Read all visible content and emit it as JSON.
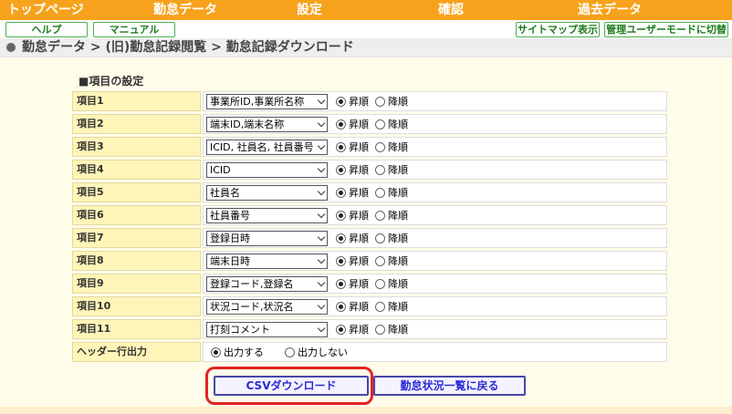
{
  "top_nav": [
    "トップページ",
    "勤怠データ",
    "設定",
    "確認",
    "過去データ"
  ],
  "sub_buttons": {
    "help": "ヘルプ",
    "manual": "マニュアル",
    "sitemap": "サイトマップ表示",
    "admin_mode": "管理ユーザーモードに切替"
  },
  "breadcrumb": "勤怠データ > (旧)勤怠記録閲覧 > 勤怠記録ダウンロード",
  "section_title": "■項目の設定",
  "sort_labels": {
    "asc": "昇順",
    "desc": "降順"
  },
  "items": [
    {
      "label": "項目1",
      "value": "事業所ID,事業所名称",
      "order": "asc"
    },
    {
      "label": "項目2",
      "value": "端末ID,端末名称",
      "order": "asc"
    },
    {
      "label": "項目3",
      "value": "ICID, 社員名, 社員番号",
      "order": "asc"
    },
    {
      "label": "項目4",
      "value": "ICID",
      "order": "asc"
    },
    {
      "label": "項目5",
      "value": "社員名",
      "order": "asc"
    },
    {
      "label": "項目6",
      "value": "社員番号",
      "order": "asc"
    },
    {
      "label": "項目7",
      "value": "登録日時",
      "order": "asc"
    },
    {
      "label": "項目8",
      "value": "端末日時",
      "order": "asc"
    },
    {
      "label": "項目9",
      "value": "登録コード,登録名",
      "order": "asc"
    },
    {
      "label": "項目10",
      "value": "状況コード,状況名",
      "order": "asc"
    },
    {
      "label": "項目11",
      "value": "打刻コメント",
      "order": "asc"
    }
  ],
  "header_row": {
    "label": "ヘッダー行出力",
    "output": "出力する",
    "no_output": "出力しない",
    "selected": "output"
  },
  "actions": {
    "csv_download": "CSVダウンロード",
    "back": "勤怠状況一覧に戻る"
  },
  "colors": {
    "nav_bg": "#f7a21c",
    "label_bg": "#fff5b8",
    "content_bg": "#fffde9",
    "highlight": "#e12424",
    "button_text": "#2a2ad6"
  }
}
